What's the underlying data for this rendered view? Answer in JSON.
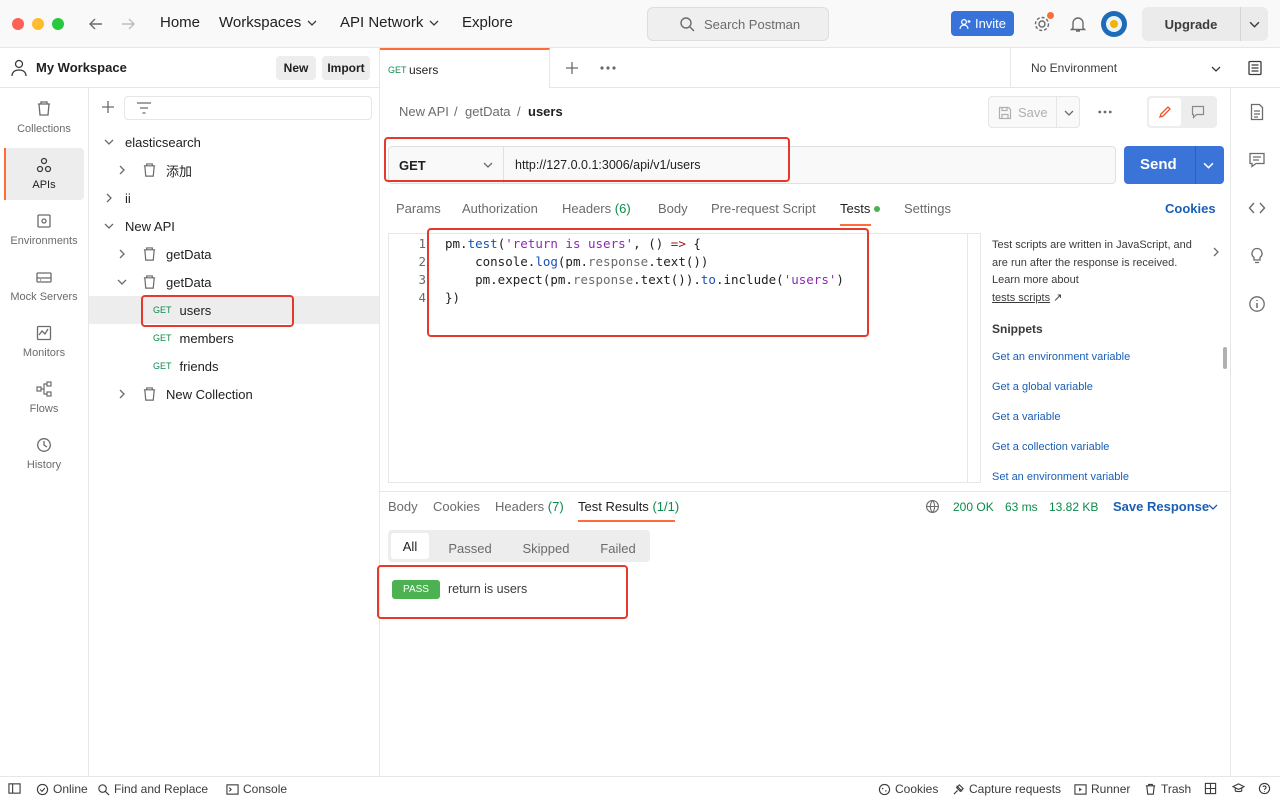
{
  "titlebar": {
    "nav": [
      "Home",
      "Workspaces",
      "API Network",
      "Explore"
    ],
    "search_placeholder": "Search Postman",
    "invite_label": "Invite",
    "upgrade_label": "Upgrade"
  },
  "workspace": {
    "name": "My Workspace",
    "new_label": "New",
    "import_label": "Import"
  },
  "rail": [
    "Collections",
    "APIs",
    "Environments",
    "Mock Servers",
    "Monitors",
    "Flows",
    "History"
  ],
  "tree": {
    "elasticsearch": "elasticsearch",
    "addition": "添加",
    "ii": "ii",
    "new_api": "New API",
    "getdata1": "getData",
    "getdata2": "getData",
    "req_users": {
      "method": "GET",
      "name": "users"
    },
    "req_members": {
      "method": "GET",
      "name": "members"
    },
    "req_friends": {
      "method": "GET",
      "name": "friends"
    },
    "new_collection": "New Collection"
  },
  "tab": {
    "method": "GET",
    "name": "users"
  },
  "environment": "No Environment",
  "breadcrumb": {
    "a": "New API",
    "sep": "/",
    "b": "getData",
    "c": "users"
  },
  "save_label": "Save",
  "request": {
    "method": "GET",
    "url": "http://127.0.0.1:3006/api/v1/users",
    "send_label": "Send"
  },
  "req_tabs": {
    "params": "Params",
    "authorization": "Authorization",
    "headers": "Headers",
    "headers_count": "(6)",
    "body": "Body",
    "prerequest": "Pre-request Script",
    "tests": "Tests",
    "settings": "Settings",
    "cookies": "Cookies"
  },
  "code": {
    "l1_a": "pm.",
    "l1_b": "test",
    "l1_c": "(",
    "l1_d": "'return is users'",
    "l1_e": ", () ",
    "l1_f": "=>",
    "l1_g": " {",
    "l2_a": "    console.",
    "l2_b": "log",
    "l2_c": "(pm.",
    "l2_d": "response",
    "l2_e": ".text())",
    "l3_a": "    pm.expect(pm.",
    "l3_b": "response",
    "l3_c": ".text()).",
    "l3_d": "to",
    "l3_e": ".include(",
    "l3_f": "'users'",
    "l3_g": ")",
    "l4": "})",
    "numbers": [
      "1",
      "2",
      "3",
      "4"
    ]
  },
  "help": {
    "text": "Test scripts are written in JavaScript, and are run after the response is received. Learn more about",
    "link": "tests scripts",
    "snippets_title": "Snippets",
    "snippets": [
      "Get an environment variable",
      "Get a global variable",
      "Get a variable",
      "Get a collection variable",
      "Set an environment variable"
    ]
  },
  "response": {
    "tabs": {
      "body": "Body",
      "cookies": "Cookies",
      "headers": "Headers",
      "headers_count": "(7)",
      "test_results": "Test Results",
      "test_results_count": "(1/1)"
    },
    "status": "200 OK",
    "time": "63 ms",
    "size": "13.82 KB",
    "save_response": "Save Response",
    "filters": [
      "All",
      "Passed",
      "Skipped",
      "Failed"
    ],
    "result": {
      "badge": "PASS",
      "name": "return is users"
    }
  },
  "statusbar": {
    "online": "Online",
    "find_replace": "Find and Replace",
    "console": "Console",
    "cookies": "Cookies",
    "capture": "Capture requests",
    "runner": "Runner",
    "trash": "Trash"
  },
  "colors": {
    "accent": "#ff6c37",
    "primary": "#3a74d8",
    "pass": "#4cb251",
    "annotation": "#e53a2b"
  }
}
